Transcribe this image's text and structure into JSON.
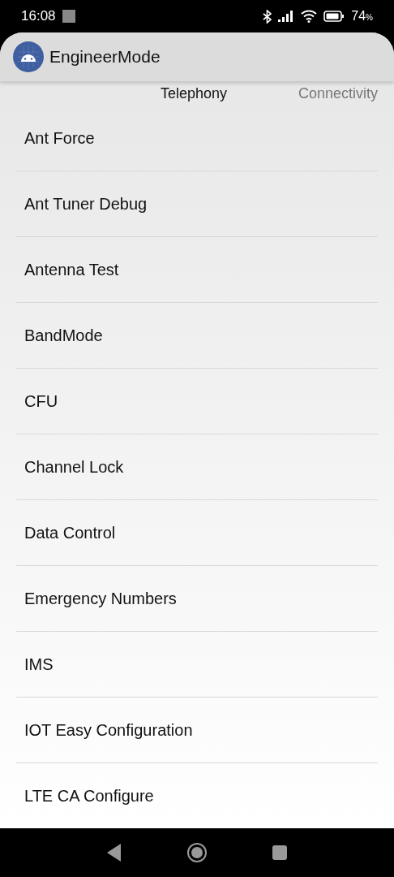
{
  "status_bar": {
    "time": "16:08",
    "battery": "74",
    "battery_unit": "%"
  },
  "app_bar": {
    "title": "EngineerMode"
  },
  "tabs": [
    {
      "label": "Telephony",
      "selected": true
    },
    {
      "label": "Connectivity",
      "selected": false
    }
  ],
  "items": [
    {
      "label": "Ant Force"
    },
    {
      "label": "Ant Tuner Debug"
    },
    {
      "label": "Antenna Test"
    },
    {
      "label": "BandMode"
    },
    {
      "label": "CFU"
    },
    {
      "label": "Channel Lock"
    },
    {
      "label": "Data Control"
    },
    {
      "label": "Emergency Numbers"
    },
    {
      "label": "IMS"
    },
    {
      "label": "IOT Easy Configuration"
    },
    {
      "label": "LTE CA Configure"
    }
  ]
}
